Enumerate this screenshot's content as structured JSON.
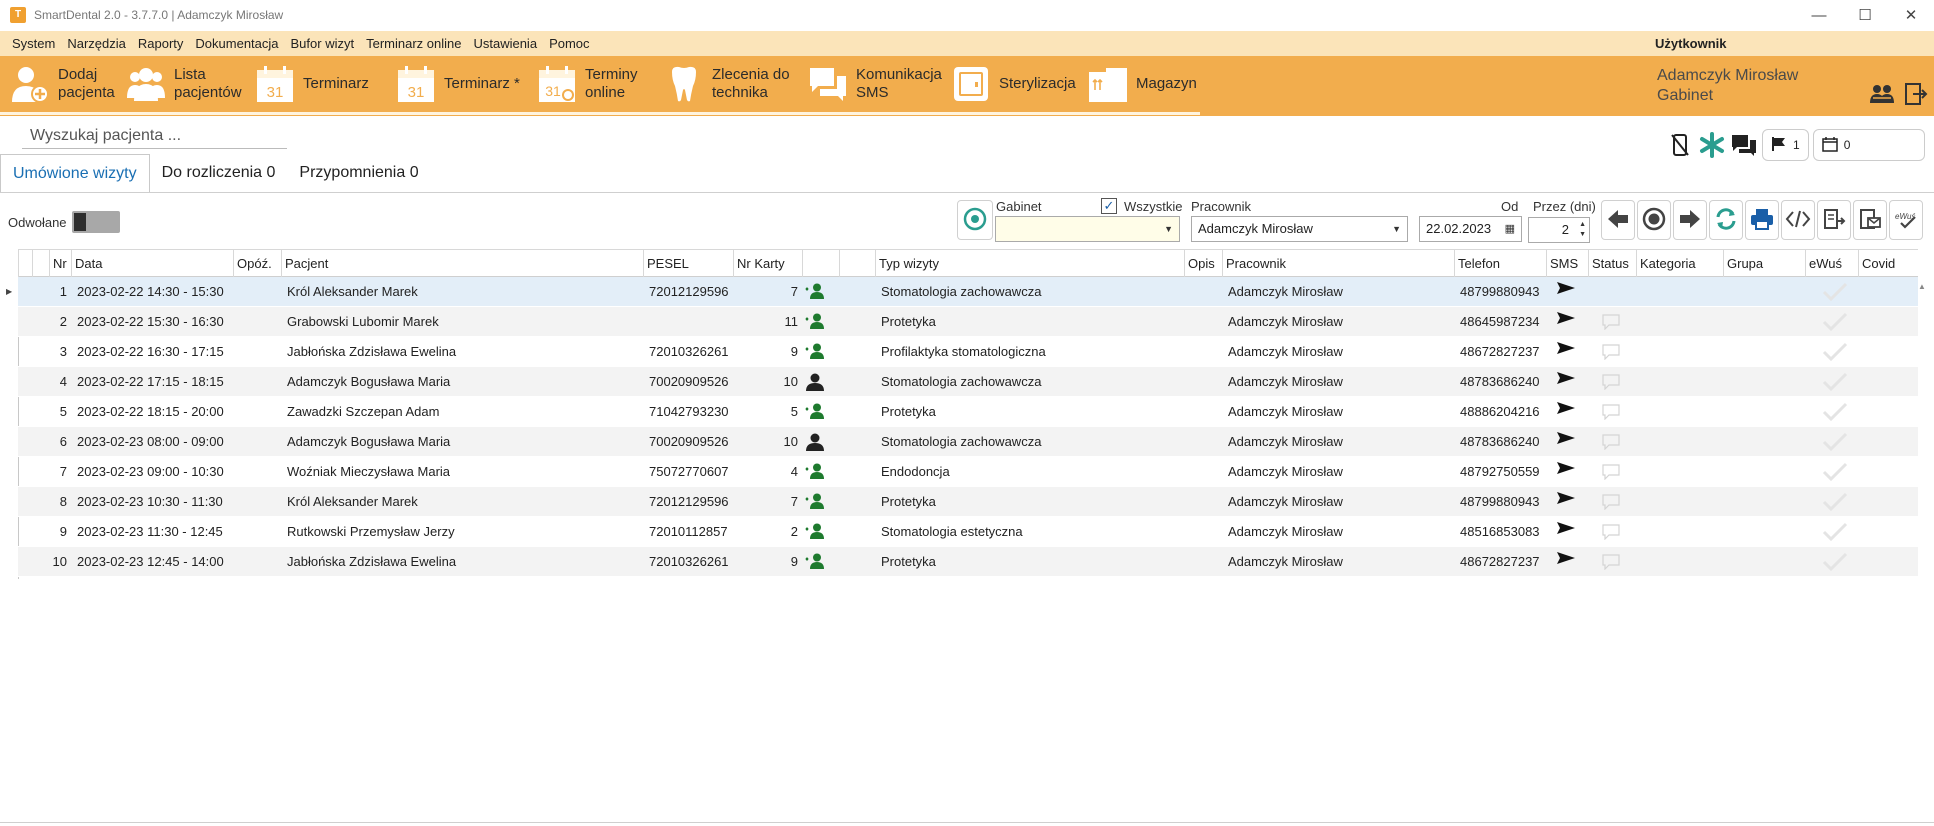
{
  "window": {
    "title": "SmartDental 2.0 - 3.7.7.0 | Adamczyk Mirosław",
    "minimize": "—",
    "maximize": "☐",
    "close": "✕"
  },
  "menu": {
    "items": [
      "System",
      "Narzędzia",
      "Raporty",
      "Dokumentacja",
      "Bufor wizyt",
      "Terminarz online",
      "Ustawienia",
      "Pomoc"
    ],
    "user_label": "Użytkownik"
  },
  "toolbar": {
    "buttons": [
      {
        "label": "Dodaj\npacjenta",
        "icon": "add-patient-icon"
      },
      {
        "label": "Lista\npacjentów",
        "icon": "patients-list-icon"
      },
      {
        "label": "Terminarz",
        "icon": "calendar-icon"
      },
      {
        "label": "Terminarz *",
        "icon": "calendar-icon"
      },
      {
        "label": "Terminy\nonline",
        "icon": "calendar-online-icon"
      },
      {
        "label": "Zlecenia do\ntechnika",
        "icon": "tooth-icon"
      },
      {
        "label": "Komunikacja\nSMS",
        "icon": "chat-icon"
      },
      {
        "label": "Sterylizacja",
        "icon": "sterilizer-icon"
      },
      {
        "label": "Magazyn",
        "icon": "warehouse-icon"
      }
    ],
    "user_name": "Adamczyk Mirosław",
    "user_room": "Gabinet",
    "brand_color": "#f2ad4d"
  },
  "search": {
    "placeholder": "Wyszukaj pacjenta ..."
  },
  "status_tools": {
    "flag_count": "1",
    "calendar_count": "0"
  },
  "tabs": [
    {
      "label": "Umówione wizyty",
      "active": true
    },
    {
      "label": "Do rozliczenia 0",
      "active": false
    },
    {
      "label": "Przypomnienia 0",
      "active": false
    }
  ],
  "filters": {
    "cancelled_label": "Odwołane",
    "cancelled_on": false,
    "room_label": "Gabinet",
    "room_value": "",
    "all_label": "Wszystkie",
    "all_checked": true,
    "employee_label": "Pracownik",
    "employee_value": "Adamczyk Mirosław",
    "from_label": "Od",
    "from_value": "22.02.2023",
    "days_label": "Przez (dni)",
    "days_value": "2"
  },
  "grid": {
    "columns": [
      "Nr",
      "Data",
      "Opóź.",
      "Pacjent",
      "PESEL",
      "Nr Karty",
      "",
      "",
      "Typ wizyty",
      "Opis",
      "Pracownik",
      "Telefon",
      "SMS",
      "Status",
      "Kategoria",
      "Grupa",
      "eWuś",
      "Covid"
    ],
    "rows": [
      {
        "nr": "1",
        "data": "2023-02-22 14:30 - 15:30",
        "pacjent": "Król Aleksander Marek",
        "pesel": "72012129596",
        "karta": "7",
        "registered": true,
        "typ": "Stomatologia zachowawcza",
        "pracownik": "Adamczyk Mirosław",
        "telefon": "48799880943",
        "status_msg": false
      },
      {
        "nr": "2",
        "data": "2023-02-22 15:30 - 16:30",
        "pacjent": "Grabowski Lubomir Marek",
        "pesel": "",
        "karta": "11",
        "registered": true,
        "typ": "Protetyka",
        "pracownik": "Adamczyk Mirosław",
        "telefon": "48645987234",
        "status_msg": true
      },
      {
        "nr": "3",
        "data": "2023-02-22 16:30 - 17:15",
        "pacjent": "Jabłońska Zdzisława Ewelina",
        "pesel": "72010326261",
        "karta": "9",
        "registered": true,
        "typ": "Profilaktyka stomatologiczna",
        "pracownik": "Adamczyk Mirosław",
        "telefon": "48672827237",
        "status_msg": true
      },
      {
        "nr": "4",
        "data": "2023-02-22 17:15 - 18:15",
        "pacjent": "Adamczyk Bogusława Maria",
        "pesel": "70020909526",
        "karta": "10",
        "registered": false,
        "typ": "Stomatologia zachowawcza",
        "pracownik": "Adamczyk Mirosław",
        "telefon": "48783686240",
        "status_msg": true
      },
      {
        "nr": "5",
        "data": "2023-02-22 18:15 - 20:00",
        "pacjent": "Zawadzki Szczepan Adam",
        "pesel": "71042793230",
        "karta": "5",
        "registered": true,
        "typ": "Protetyka",
        "pracownik": "Adamczyk Mirosław",
        "telefon": "48886204216",
        "status_msg": true
      },
      {
        "nr": "6",
        "data": "2023-02-23 08:00 - 09:00",
        "pacjent": "Adamczyk Bogusława Maria",
        "pesel": "70020909526",
        "karta": "10",
        "registered": false,
        "typ": "Stomatologia zachowawcza",
        "pracownik": "Adamczyk Mirosław",
        "telefon": "48783686240",
        "status_msg": true
      },
      {
        "nr": "7",
        "data": "2023-02-23 09:00 - 10:30",
        "pacjent": "Woźniak Mieczysława Maria",
        "pesel": "75072770607",
        "karta": "4",
        "registered": true,
        "typ": "Endodoncja",
        "pracownik": "Adamczyk Mirosław",
        "telefon": "48792750559",
        "status_msg": true
      },
      {
        "nr": "8",
        "data": "2023-02-23 10:30 - 11:30",
        "pacjent": "Król Aleksander Marek",
        "pesel": "72012129596",
        "karta": "7",
        "registered": true,
        "typ": "Protetyka",
        "pracownik": "Adamczyk Mirosław",
        "telefon": "48799880943",
        "status_msg": true
      },
      {
        "nr": "9",
        "data": "2023-02-23 11:30 - 12:45",
        "pacjent": "Rutkowski Przemysław Jerzy",
        "pesel": "72010112857",
        "karta": "2",
        "registered": true,
        "typ": "Stomatologia estetyczna",
        "pracownik": "Adamczyk Mirosław",
        "telefon": "48516853083",
        "status_msg": true
      },
      {
        "nr": "10",
        "data": "2023-02-23 12:45 - 14:00",
        "pacjent": "Jabłońska Zdzisława Ewelina",
        "pesel": "72010326261",
        "karta": "9",
        "registered": true,
        "typ": "Protetyka",
        "pracownik": "Adamczyk Mirosław",
        "telefon": "48672827237",
        "status_msg": true
      }
    ],
    "selected_row": 0
  }
}
